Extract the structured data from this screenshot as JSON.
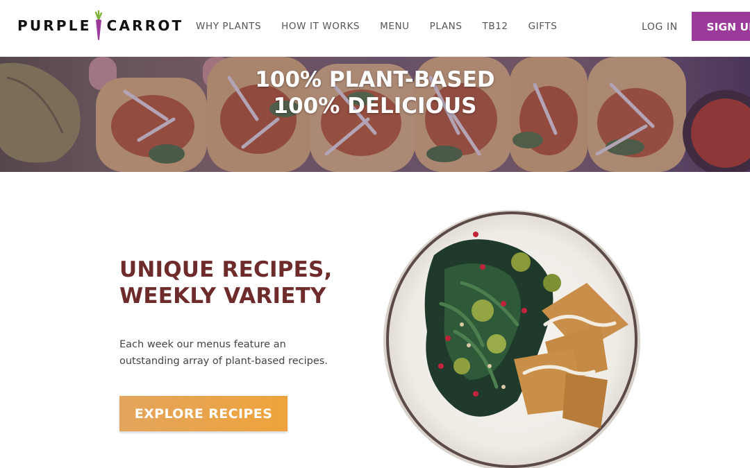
{
  "brand": {
    "name_left": "PURPLE",
    "name_right": "CARROT",
    "logo_icon": "carrot-icon",
    "color_purple": "#9b3a9b",
    "color_leaf": "#7fb33a"
  },
  "nav": {
    "items": [
      {
        "label": "WHY PLANTS"
      },
      {
        "label": "HOW IT WORKS"
      },
      {
        "label": "MENU"
      },
      {
        "label": "PLANS"
      },
      {
        "label": "TB12"
      },
      {
        "label": "GIFTS"
      }
    ],
    "login_label": "LOG IN",
    "signup_label": "SIGN UP"
  },
  "hero": {
    "line1": "100% PLANT-BASED",
    "line2": "100% DELICIOUS"
  },
  "feature": {
    "title_line1": "UNIQUE RECIPES,",
    "title_line2": "WEEKLY VARIETY",
    "description": "Each week our menus feature an outstanding array of plant-based recipes.",
    "cta_label": "EXPLORE RECIPES",
    "title_color": "#6e2b2b",
    "cta_color": "#eea33b"
  }
}
